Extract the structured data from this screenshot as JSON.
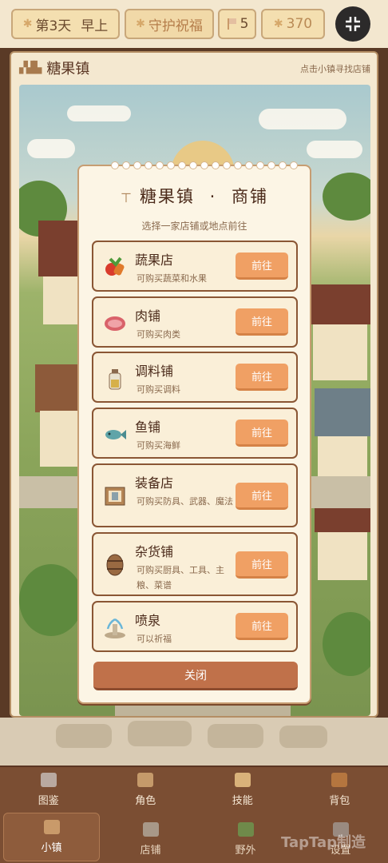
{
  "top_bar": {
    "day": "第3天",
    "time_of_day": "早上",
    "blessing": "守护祝福",
    "flag_count": "5",
    "coins": "370"
  },
  "town": {
    "title": "糖果镇",
    "hint": "点击小镇寻找店铺"
  },
  "modal": {
    "title": "糖果镇",
    "title_separator": "·",
    "title_suffix": "商铺",
    "subtitle": "选择一家店铺或地点前往",
    "close_label": "关闭",
    "shops": [
      {
        "name": "蔬果店",
        "desc": "可购买蔬菜和水果",
        "button": "前往",
        "icon": "vegetable-icon"
      },
      {
        "name": "肉铺",
        "desc": "可购买肉类",
        "button": "前往",
        "icon": "meat-icon"
      },
      {
        "name": "调料铺",
        "desc": "可购买调料",
        "button": "前往",
        "icon": "spice-jar-icon"
      },
      {
        "name": "鱼铺",
        "desc": "可购买海鲜",
        "button": "前往",
        "icon": "fish-icon"
      },
      {
        "name": "装备店",
        "desc": "可购买防具、武器、魔法",
        "button": "前往",
        "icon": "equipment-icon"
      },
      {
        "name": "杂货铺",
        "desc": "可购买厨具、工具、主粮、菜谱",
        "button": "前往",
        "icon": "barrel-icon"
      },
      {
        "name": "喷泉",
        "desc": "可以祈福",
        "button": "前往",
        "icon": "fountain-icon"
      }
    ]
  },
  "nav_primary": [
    {
      "label": "图鉴",
      "icon": "book-icon"
    },
    {
      "label": "角色",
      "icon": "portrait-icon"
    },
    {
      "label": "技能",
      "icon": "skill-book-icon"
    },
    {
      "label": "背包",
      "icon": "backpack-icon"
    }
  ],
  "nav_secondary": [
    {
      "label": "小镇",
      "icon": "house-icon",
      "active": true
    },
    {
      "label": "店铺",
      "icon": "shop-icon",
      "active": false
    },
    {
      "label": "野外",
      "icon": "tree-icon",
      "active": false
    },
    {
      "label": "设置",
      "icon": "gear-icon",
      "active": false
    }
  ],
  "watermark": "TapTap制造",
  "colors": {
    "accent_button": "#f0a064",
    "close_button": "#c0714a",
    "nav_bg": "#7b4e33",
    "panel_bg": "#fcf5e5"
  }
}
